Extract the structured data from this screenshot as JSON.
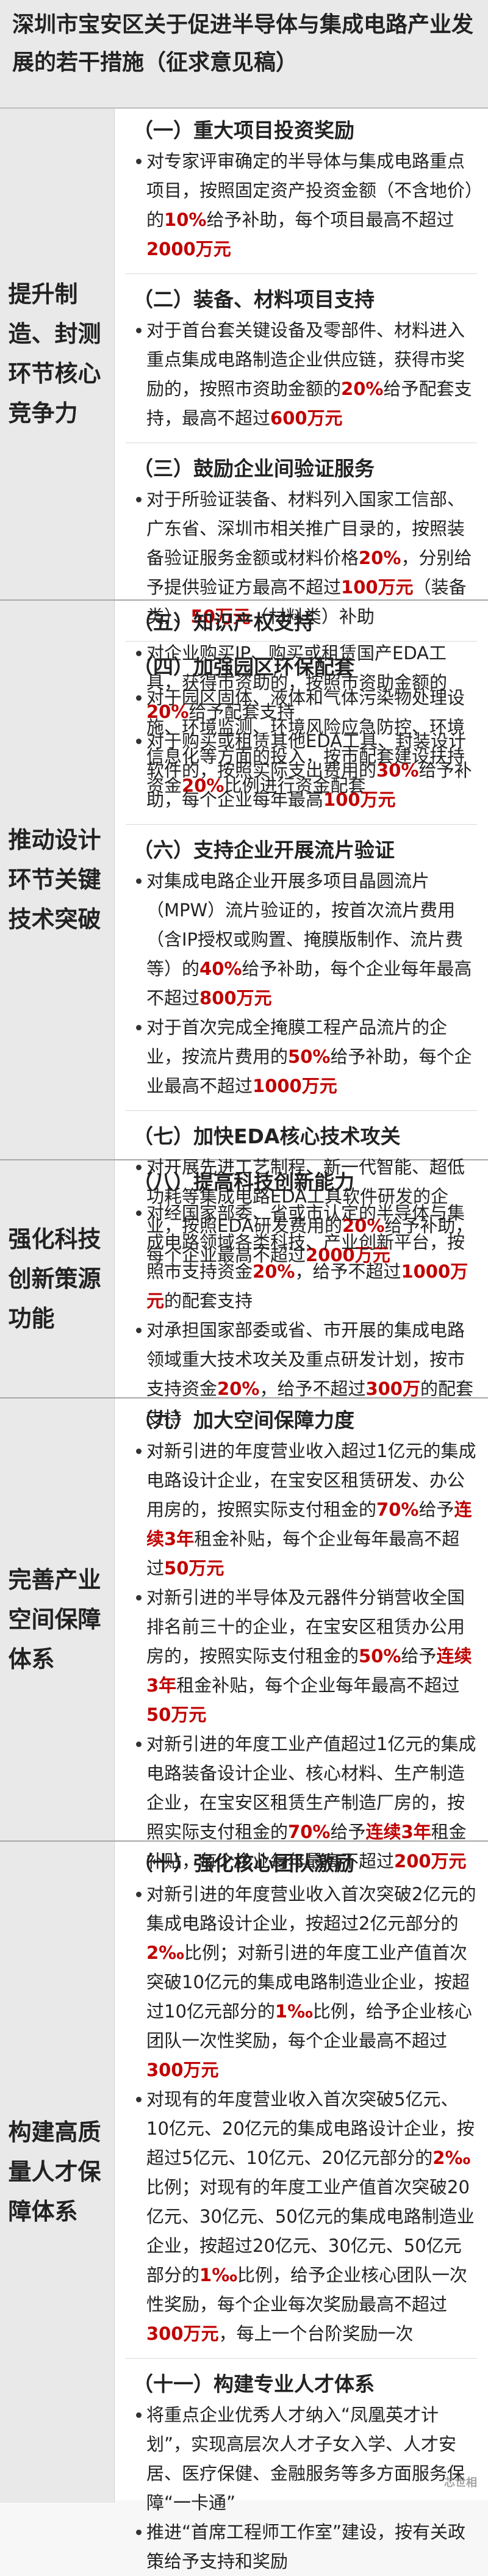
{
  "title": "深圳市宝安区关于促进半导体与集成电路产业发展的若干措施（征求意见稿）",
  "sections": [
    {
      "left": "提升制造、封测环节核心竞争力",
      "items": [
        {
          "title": "（一）重大项目投资奖励",
          "bullets": [
            [
              {
                "t": "对专家评审确定的半导体与集成电路重点项目，按照固定资产投资金额（不含地价）的"
              },
              {
                "t": "10%",
                "r": true
              },
              {
                "t": "给予补助，每个项目最高不超过"
              },
              {
                "t": "2000万元",
                "r": true
              }
            ]
          ]
        },
        {
          "title": "（二）装备、材料项目支持",
          "bullets": [
            [
              {
                "t": "对于首台套关键设备及零部件、材料进入重点集成电路制造企业供应链，获得市奖励的，按照市资助金额的"
              },
              {
                "t": "20%",
                "r": true
              },
              {
                "t": "给予配套支持，最高不超过"
              },
              {
                "t": "600万元",
                "r": true
              }
            ]
          ]
        },
        {
          "title": "（三）鼓励企业间验证服务",
          "bullets": [
            [
              {
                "t": "对于所验证装备、材料列入国家工信部、广东省、深圳市相关推广目录的，按照装备验证服务金额或材料价格"
              },
              {
                "t": "20%",
                "r": true
              },
              {
                "t": "，分别给予提供验证方最高不超过"
              },
              {
                "t": "100万元",
                "r": true
              },
              {
                "t": "（装备类）、"
              },
              {
                "t": "50万元",
                "r": true
              },
              {
                "t": "（材料类）补助"
              }
            ]
          ]
        },
        {
          "title": "（四）加强园区环保配套",
          "bullets": [
            [
              {
                "t": "对于园区固体、液体和气体污染物处理设施、环境监测、环境风险应急防控、环境信息化等方面的投入，按市配套建设扶持资金"
              },
              {
                "t": "20%",
                "r": true
              },
              {
                "t": "比例进行资金配套"
              }
            ]
          ]
        }
      ]
    },
    {
      "left": "推动设计环节关键技术突破",
      "items": [
        {
          "title": "（五）知识产权支持",
          "bullets": [
            [
              {
                "t": "对企业购买IP、购买或租赁国产EDA工具，获得市资助的，按照市资助金额的"
              },
              {
                "t": "20%",
                "r": true
              },
              {
                "t": "给予配套支持"
              }
            ],
            [
              {
                "t": "对于购买或租赁其他EDA工具、封装设计软件的，按照实际支出费用的"
              },
              {
                "t": "30%",
                "r": true
              },
              {
                "t": "给予补助，每个企业每年最高"
              },
              {
                "t": "100万元",
                "r": true
              }
            ]
          ]
        },
        {
          "title": "（六）支持企业开展流片验证",
          "bullets": [
            [
              {
                "t": "对集成电路企业开展多项目晶圆流片（MPW）流片验证的，按首次流片费用（含IP授权或购置、掩膜版制作、流片费等）的"
              },
              {
                "t": "40%",
                "r": true
              },
              {
                "t": "给予补助，每个企业每年最高不超过"
              },
              {
                "t": "800万元",
                "r": true
              }
            ],
            [
              {
                "t": "对于首次完成全掩膜工程产品流片的企业，按流片费用的"
              },
              {
                "t": "50%",
                "r": true
              },
              {
                "t": "给予补助，每个企业最高不超过"
              },
              {
                "t": "1000万元",
                "r": true
              }
            ]
          ]
        },
        {
          "title": "（七）加快EDA核心技术攻关",
          "bullets": [
            [
              {
                "t": "对开展先进工艺制程、新一代智能、超低功耗等集成电路EDA工具软件研发的企业，按照EDA研发费用的"
              },
              {
                "t": "20%",
                "r": true
              },
              {
                "t": "给予补助，每个企业最高不超过"
              },
              {
                "t": "2000万元",
                "r": true
              }
            ]
          ]
        }
      ]
    },
    {
      "left": "强化科技创新策源功能",
      "items": [
        {
          "title": "（八）提高科技创新能力",
          "bullets": [
            [
              {
                "t": "对经国家部委、省或市认定的半导体与集成电路领域各类科技、产业创新平台，按照市支持资金"
              },
              {
                "t": "20%",
                "r": true
              },
              {
                "t": "，给予不超过"
              },
              {
                "t": "1000万元",
                "r": true
              },
              {
                "t": "的配套支持"
              }
            ],
            [
              {
                "t": "对承担国家部委或省、市开展的集成电路领域重大技术攻关及重点研发计划，按市支持资金"
              },
              {
                "t": "20%",
                "r": true
              },
              {
                "t": "，给予不超过"
              },
              {
                "t": "300万",
                "r": true
              },
              {
                "t": "的配套支持"
              }
            ]
          ]
        }
      ]
    },
    {
      "left": "完善产业空间保障体系",
      "items": [
        {
          "title": "（九）加大空间保障力度",
          "bullets": [
            [
              {
                "t": "对新引进的年度营业收入超过1亿元的集成电路设计企业，在宝安区租赁研发、办公用房的，按照实际支付租金的"
              },
              {
                "t": "70%",
                "r": true
              },
              {
                "t": "给予"
              },
              {
                "t": "连续3年",
                "r": true
              },
              {
                "t": "租金补贴，每个企业每年最高不超过"
              },
              {
                "t": "50万元",
                "r": true
              }
            ],
            [
              {
                "t": "对新引进的半导体及元器件分销营收全国排名前三十的企业，在宝安区租赁办公用房的，按照实际支付租金的"
              },
              {
                "t": "50%",
                "r": true
              },
              {
                "t": "给予"
              },
              {
                "t": "连续3年",
                "r": true
              },
              {
                "t": "租金补贴，每个企业每年最高不超过"
              },
              {
                "t": "50万元",
                "r": true
              }
            ],
            [
              {
                "t": "对新引进的年度工业产值超过1亿元的集成电路装备设计企业、核心材料、生产制造企业，在宝安区租赁生产制造厂房的，按照实际支付租金的"
              },
              {
                "t": "70%",
                "r": true
              },
              {
                "t": "给予"
              },
              {
                "t": "连续3年",
                "r": true
              },
              {
                "t": "租金补贴，每个企业每年最高不超过"
              },
              {
                "t": "200万元",
                "r": true
              }
            ]
          ]
        }
      ]
    },
    {
      "left": "构建高质量人才保障体系",
      "items": [
        {
          "title": "（十）强化核心团队激励",
          "bullets": [
            [
              {
                "t": "对新引进的年度营业收入首次突破2亿元的集成电路设计企业，按超过2亿元部分的"
              },
              {
                "t": "2‰",
                "r": true
              },
              {
                "t": "比例；对新引进的年度工业产值首次突破10亿元的集成电路制造业企业，按超过10亿元部分的"
              },
              {
                "t": "1‰",
                "r": true
              },
              {
                "t": "比例，给予企业核心团队一次性奖励，每个企业最高不超过"
              },
              {
                "t": "300万元",
                "r": true
              }
            ],
            [
              {
                "t": "对现有的年度营业收入首次突破5亿元、10亿元、20亿元的集成电路设计企业，按超过5亿元、10亿元、20亿元部分的"
              },
              {
                "t": "2‰",
                "r": true
              },
              {
                "t": "比例；对现有的年度工业产值首次突破20亿元、30亿元、50亿元的集成电路制造业企业，按超过20亿元、30亿元、50亿元部分的"
              },
              {
                "t": "1‰",
                "r": true
              },
              {
                "t": "比例，给予企业核心团队一次性奖励，每个企业每次奖励最高不超过"
              },
              {
                "t": "300万元",
                "r": true
              },
              {
                "t": "，每上一个台阶奖励一次"
              }
            ]
          ]
        },
        {
          "title": "（十一）构建专业人才体系",
          "bullets": [
            [
              {
                "t": "将重点企业优秀人才纳入“凤凰英才计划”，实现高层次人才子女入学、人才安居、医疗保健、金融服务等多方面服务保障“一卡通”"
              }
            ],
            [
              {
                "t": "推进“首席工程师工作室”建设，按有关政策给予支持和奖励"
              }
            ]
          ]
        }
      ]
    }
  ],
  "watermark": "芯世相"
}
